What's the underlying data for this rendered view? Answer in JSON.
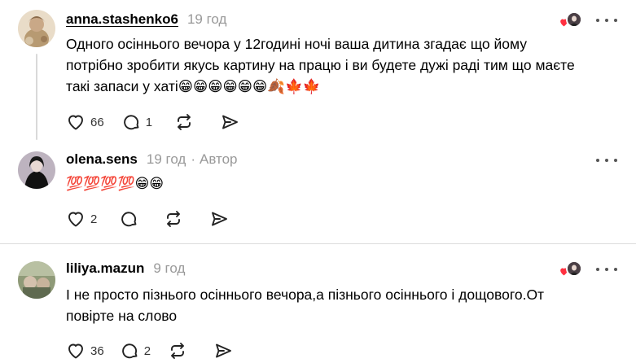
{
  "comments": [
    {
      "username": "anna.stashenko6",
      "time": "19 год",
      "text_lines": [
        "Одного осіннього вечора у 12годині ночі ваша дитина згадає що йому",
        "потрібно зробити якусь картину на працю і ви будете дужі раді тим що маєте",
        "такі запаси у хаті😁😁😁😁😁😁🍂🍁🍁"
      ],
      "likes": "66",
      "replies": "1"
    },
    {
      "username": "olena.sens",
      "time": "19 год",
      "separator": "·",
      "author_badge": "Автор",
      "text_lines": [
        "💯💯💯💯😁😁"
      ],
      "likes": "2"
    },
    {
      "username": "liliya.mazun",
      "time": "9 год",
      "text_lines": [
        "І не просто пізнього осіннього вечора,а пізнього осіннього і дощового.От",
        "повірте на слово"
      ],
      "likes": "36",
      "replies": "2"
    }
  ],
  "colors": {
    "like_heart": "#ff3040",
    "muted_text": "#999999",
    "divider": "#dcdcdc"
  },
  "icons": [
    "heart-icon",
    "comment-icon",
    "repost-icon",
    "share-icon",
    "more-icon"
  ]
}
